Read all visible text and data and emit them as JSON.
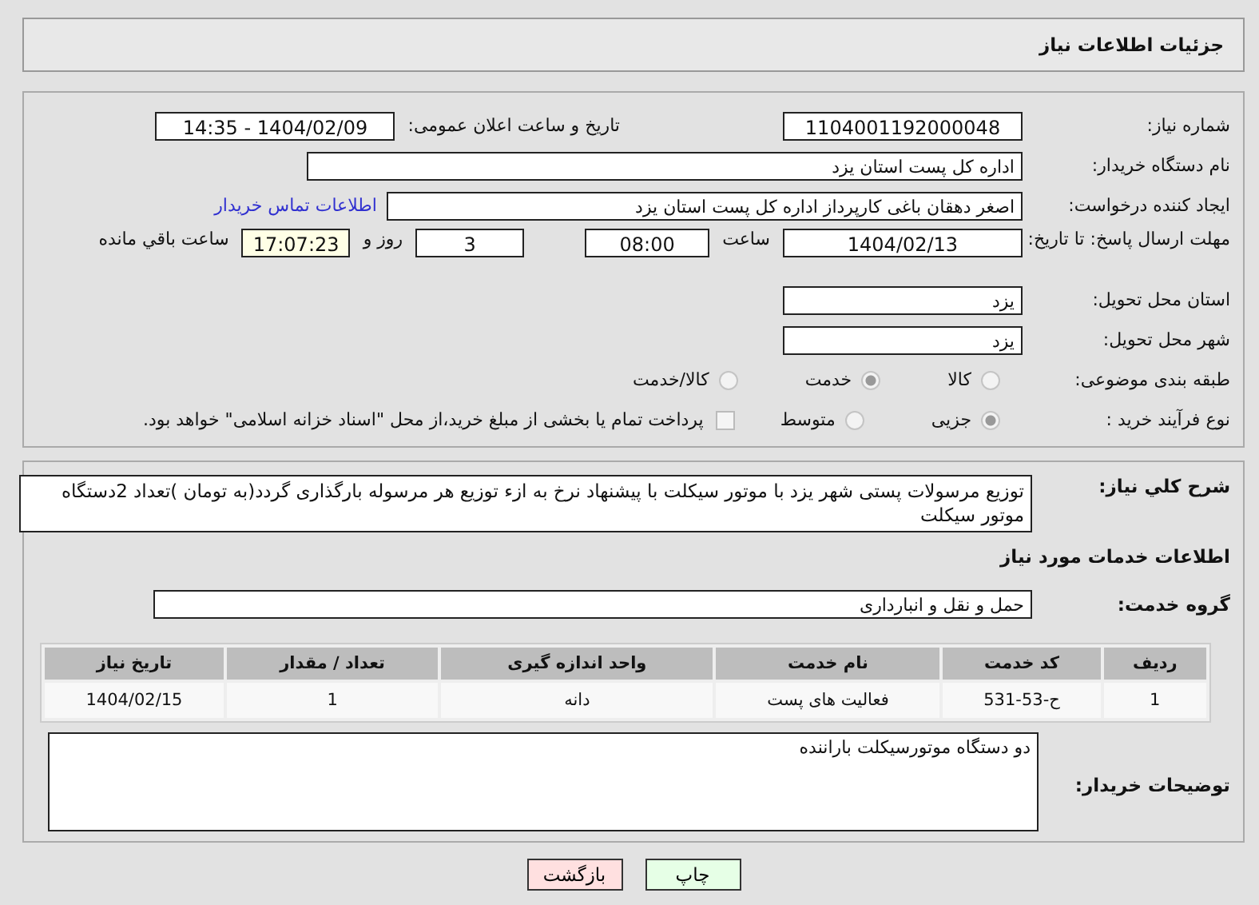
{
  "header": {
    "title": "جزئیات اطلاعات نیاز"
  },
  "need_number": {
    "label": "شماره نیاز:",
    "value": "1104001192000048"
  },
  "announce": {
    "label": "تاریخ و ساعت اعلان عمومی:",
    "value": "1404/02/09 - 14:35"
  },
  "buyer_org": {
    "label": "نام دستگاه خریدار:",
    "value": "اداره کل پست استان یزد"
  },
  "requester": {
    "label": "ایجاد کننده درخواست:",
    "value": "اصغر دهقان باغی کارپرداز اداره کل پست استان یزد",
    "link": "اطلاعات تماس خریدار"
  },
  "deadline": {
    "label": "مهلت ارسال پاسخ: تا تاریخ:",
    "date": "1404/02/13",
    "time_label": "ساعت",
    "time": "08:00",
    "days": "3",
    "days_label": "روز و",
    "remaining": "17:07:23",
    "remaining_label": "ساعت باقي مانده"
  },
  "province": {
    "label": "استان محل تحویل:",
    "value": "یزد"
  },
  "city": {
    "label": "شهر محل تحویل:",
    "value": "یزد"
  },
  "category": {
    "label": "طبقه بندی موضوعی:",
    "options": [
      {
        "label": "کالا",
        "selected": false
      },
      {
        "label": "خدمت",
        "selected": true
      },
      {
        "label": "کالا/خدمت",
        "selected": false
      }
    ]
  },
  "process": {
    "label": "نوع فرآیند خرید :",
    "options": [
      {
        "label": "جزیی",
        "selected": true
      },
      {
        "label": "متوسط",
        "selected": false
      }
    ],
    "treasury": {
      "label": "پرداخت تمام یا بخشی از مبلغ خرید،از محل \"اسناد خزانه اسلامی\" خواهد بود.",
      "checked": false
    }
  },
  "description": {
    "label": "شرح کلي نياز:",
    "value": "توزیع مرسولات پستی شهر یزد با موتور سیکلت با پیشنهاد نرخ به ازء توزیع هر مرسوله بارگذاری گردد(به تومان )تعداد 2دستگاه موتور سیکلت"
  },
  "services_heading": "اطلاعات خدمات مورد نياز",
  "service_group": {
    "label": "گروه خدمت:",
    "value": "حمل و نقل و انبارداری"
  },
  "table": {
    "columns": [
      "ردیف",
      "کد خدمت",
      "نام خدمت",
      "واحد اندازه گیری",
      "تعداد / مقدار",
      "تاریخ نیاز"
    ],
    "rows": [
      [
        "1",
        "ح-53-531",
        "فعالیت های پست",
        "دانه",
        "1",
        "1404/02/15"
      ]
    ]
  },
  "buyer_notes": {
    "label": "توضیحات خریدار:",
    "value": "دو دستگاه موتورسیکلت باراننده"
  },
  "buttons": [
    {
      "label": "چاپ",
      "kind": "print"
    },
    {
      "label": "بازگشت",
      "kind": "back"
    }
  ]
}
